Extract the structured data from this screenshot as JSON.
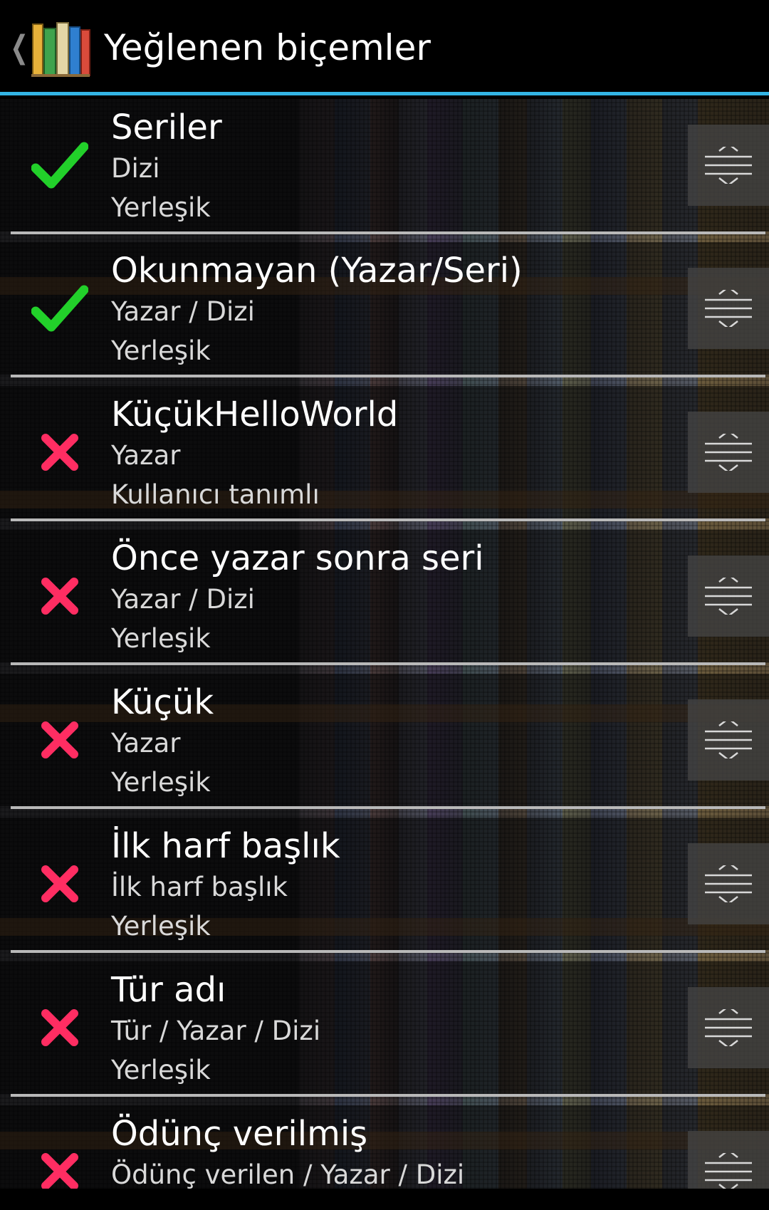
{
  "action_bar": {
    "title": "Yeğlenen biçemler"
  },
  "styles": [
    {
      "title": "Seriler",
      "groups": "Dizi",
      "kind": "Yerleşik",
      "enabled": true
    },
    {
      "title": "Okunmayan (Yazar/Seri)",
      "groups": "Yazar / Dizi",
      "kind": "Yerleşik",
      "enabled": true
    },
    {
      "title": "KüçükHelloWorld",
      "groups": "Yazar",
      "kind": "Kullanıcı tanımlı",
      "enabled": false
    },
    {
      "title": "Önce yazar sonra seri",
      "groups": "Yazar / Dizi",
      "kind": "Yerleşik",
      "enabled": false
    },
    {
      "title": "Küçük",
      "groups": "Yazar",
      "kind": "Yerleşik",
      "enabled": false
    },
    {
      "title": "İlk harf başlık",
      "groups": "İlk harf başlık",
      "kind": "Yerleşik",
      "enabled": false
    },
    {
      "title": "Tür adı",
      "groups": "Tür / Yazar / Dizi",
      "kind": "Yerleşik",
      "enabled": false
    },
    {
      "title": "Ödünç verilmiş",
      "groups": "Ödünç verilen / Yazar / Dizi",
      "kind": "",
      "enabled": false
    }
  ],
  "colors": {
    "accent": "#33b5e5",
    "check": "#22d02a",
    "cross": "#ff2d62"
  },
  "icons": {
    "enabled": "checkmark-icon",
    "disabled": "cross-icon",
    "drag": "drag-handle-icon",
    "up": "up-caret-icon",
    "app": "bookshelf-app-icon"
  }
}
